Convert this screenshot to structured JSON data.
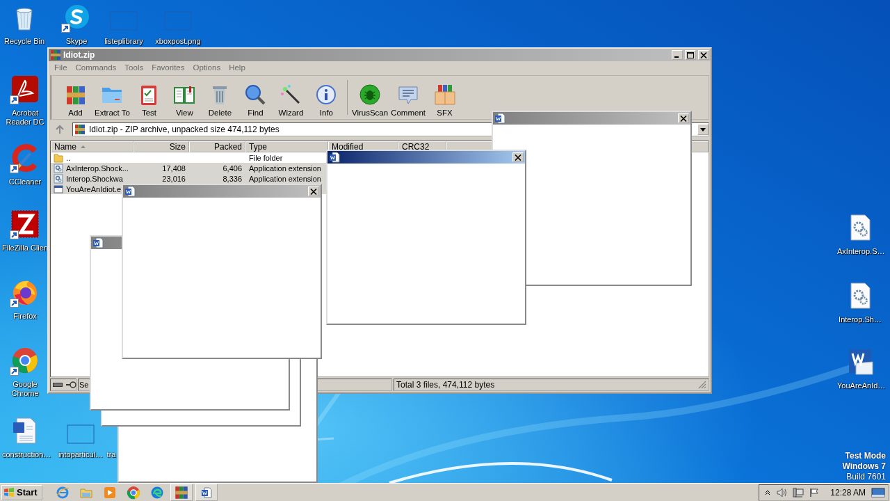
{
  "desktop": {
    "icons": [
      {
        "kind": "recycle-bin",
        "label": "Recycle Bin",
        "shortcut": false
      },
      {
        "kind": "round-logo",
        "label": "Skype",
        "shortcut": true
      },
      {
        "kind": "blank",
        "label": "listeplibrary",
        "shortcut": false
      },
      {
        "kind": "blank",
        "label": "xboxpost.png",
        "shortcut": false
      },
      {
        "kind": "pdf-reader",
        "label": "Acrobat Reader DC",
        "shortcut": true
      },
      {
        "kind": "brush",
        "label": "CCleaner",
        "shortcut": true
      },
      {
        "kind": "app-logo",
        "label": "FileZilla Clien",
        "shortcut": true
      },
      {
        "kind": "fox-globe",
        "label": "Firefox",
        "shortcut": true
      },
      {
        "kind": "browser",
        "label": "Google Chrome",
        "shortcut": true
      },
      {
        "kind": "document",
        "label": "construction…",
        "shortcut": false
      },
      {
        "kind": "blank",
        "label": "intoparticul…",
        "shortcut": false
      },
      {
        "kind": "none",
        "label": "tra",
        "shortcut": false
      },
      {
        "kind": "gear-document",
        "label": "AxInterop.S…",
        "shortcut": false
      },
      {
        "kind": "gear-document",
        "label": "Interop.Sh…",
        "shortcut": false
      },
      {
        "kind": "word-document",
        "label": "YouAreAnId…",
        "shortcut": false
      }
    ],
    "system_text": [
      {
        "text": "Test Mode",
        "bold": true
      },
      {
        "text": "Windows 7",
        "bold": true
      },
      {
        "text": "Build 7601",
        "bold": false
      }
    ]
  },
  "archive_window": {
    "title": "Idiot.zip",
    "active": false,
    "menu": [
      "File",
      "Commands",
      "Tools",
      "Favorites",
      "Options",
      "Help"
    ],
    "toolbar": [
      {
        "kind": "add",
        "label": "Add",
        "separator_before": false
      },
      {
        "kind": "extract",
        "label": "Extract To",
        "separator_before": false
      },
      {
        "kind": "test",
        "label": "Test",
        "separator_before": false
      },
      {
        "kind": "view",
        "label": "View",
        "separator_before": false
      },
      {
        "kind": "delete",
        "label": "Delete",
        "separator_before": false
      },
      {
        "kind": "find",
        "label": "Find",
        "separator_before": false
      },
      {
        "kind": "wizard",
        "label": "Wizard",
        "separator_before": false
      },
      {
        "kind": "info",
        "label": "Info",
        "separator_before": false
      },
      {
        "kind": "virusscan",
        "label": "VirusScan",
        "separator_before": true
      },
      {
        "kind": "comment",
        "label": "Comment",
        "separator_before": false
      },
      {
        "kind": "sfx",
        "label": "SFX",
        "separator_before": false
      }
    ],
    "address": "Idiot.zip - ZIP archive, unpacked size 474,112 bytes",
    "columns": [
      {
        "label": "Name",
        "sorted": true
      },
      {
        "label": "Size",
        "sorted": false
      },
      {
        "label": "Packed",
        "sorted": false
      },
      {
        "label": "Type",
        "sorted": false
      },
      {
        "label": "Modified",
        "sorted": false
      },
      {
        "label": "CRC32",
        "sorted": false
      }
    ],
    "rows": [
      {
        "kind": "folder",
        "name": "..",
        "type": "File folder",
        "selected": false
      },
      {
        "kind": "library",
        "name": "AxInterop.Shock...",
        "size": "17,408",
        "packed": "6,406",
        "type": "Application extension",
        "selected": true
      },
      {
        "kind": "library",
        "name": "Interop.Shockwa",
        "size": "23,016",
        "packed": "8,336",
        "type": "Application extension",
        "selected": true
      },
      {
        "kind": "program",
        "name": "YouAreAnIdiot.e",
        "selected": true
      }
    ],
    "status": {
      "left": "Se",
      "total": "Total 3 files, 474,112 bytes"
    }
  },
  "popup_windows": [
    {
      "kind": "dialog",
      "active": false
    },
    {
      "kind": "dialog",
      "active": true
    },
    {
      "kind": "dialog"
    },
    {
      "kind": "dialog"
    },
    {
      "kind": "dialog",
      "active": false
    },
    {
      "kind": "dialog",
      "active": false
    }
  ],
  "taskbar": {
    "start": "Start",
    "programs": [
      {
        "kind": "ie",
        "running": false
      },
      {
        "kind": "explorer",
        "running": false
      },
      {
        "kind": "media",
        "running": false
      },
      {
        "kind": "chrome",
        "running": false
      },
      {
        "kind": "edge",
        "running": false
      },
      {
        "kind": "archiver",
        "running": true
      },
      {
        "kind": "word",
        "running": true
      }
    ],
    "clock": "12:28 AM"
  }
}
